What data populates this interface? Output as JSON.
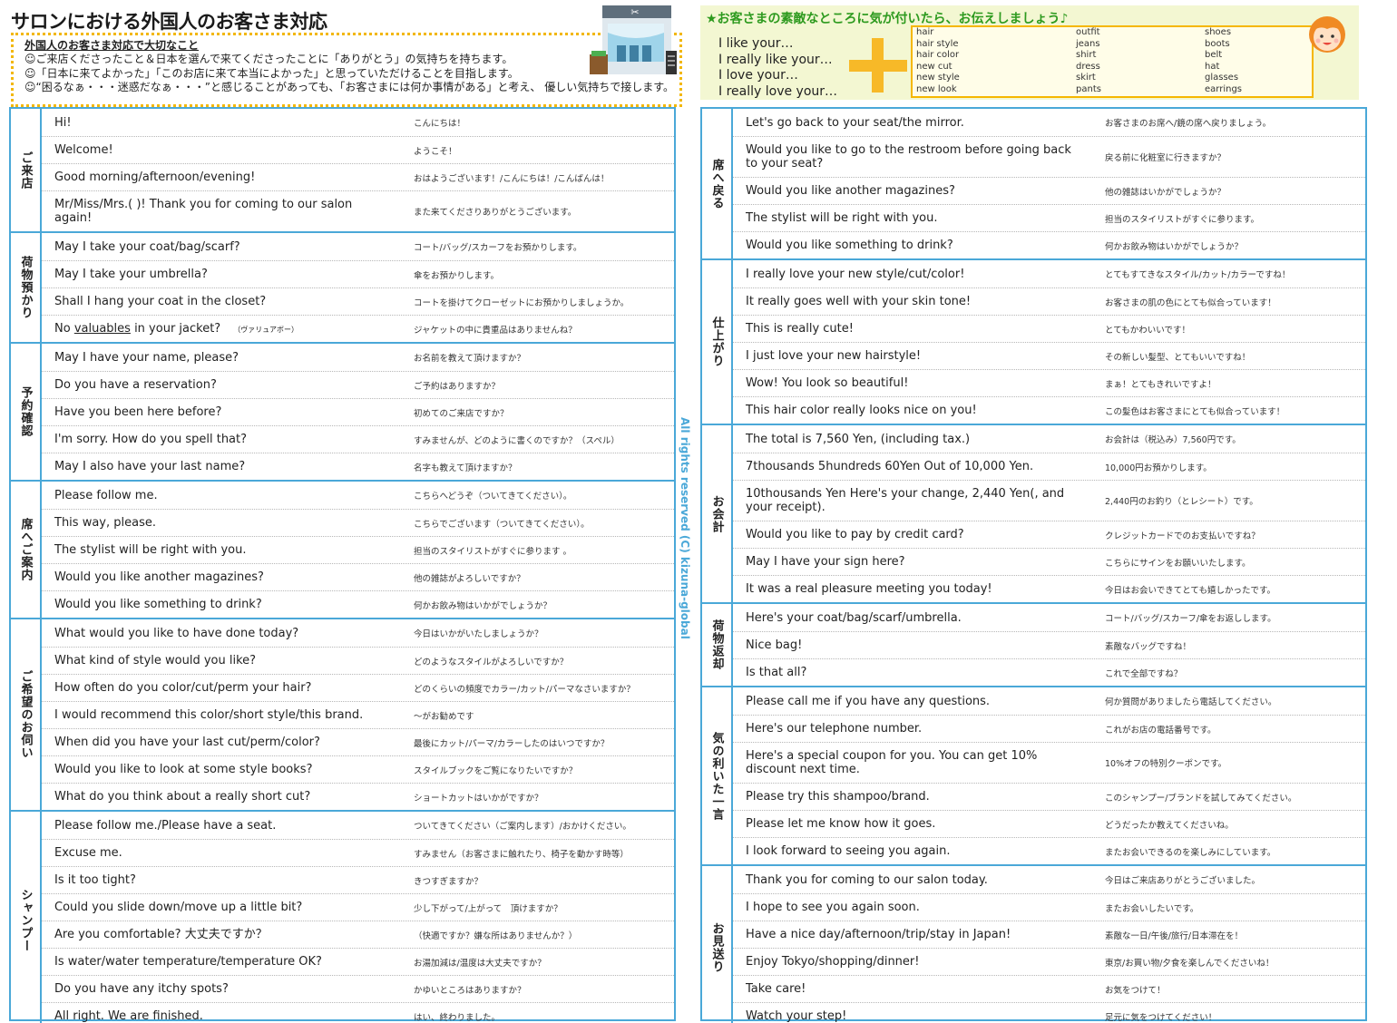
{
  "title": "サロンにおける外国人のお客さま対応",
  "notes": {
    "heading": "外国人のお客さま対応で大切なこと",
    "lines": [
      "☺ご来店くださったこと＆日本を選んで来てくださったことに「ありがとう」の気持ちを持ちます。",
      "☺「日本に来てよかった」「このお店に来て本当によかった」と思っていただけることを目指します。",
      "☺“困るなぁ・・・迷惑だなぁ・・・”と感じることがあっても、「お客さまには何か事情がある」と考え、 優しい気持ちで接します。"
    ]
  },
  "tip": {
    "title": "★お客さまの素敵なところに気が付いたら、お伝えしましょう♪",
    "phrases": [
      "I like your…",
      "I really like your…",
      "I love your…",
      "I really love your…"
    ],
    "words_col1": [
      "hair",
      "hair style",
      "hair color",
      "new cut",
      "new style",
      "new look"
    ],
    "words_col2": [
      "outfit",
      "jeans",
      "shirt",
      "dress",
      "skirt",
      "pants"
    ],
    "words_col3": [
      "shoes",
      "boots",
      "belt",
      "hat",
      "glasses",
      "earrings"
    ]
  },
  "copyright": "All rights reserved (C) kizuna-global",
  "colors": {
    "border": "#4aa8d8",
    "accent_yellow": "#f5b700",
    "tip_green": "#2d9a1e",
    "tip_bg": "#f3f7d2"
  },
  "left_sections": [
    {
      "label": "ご来店",
      "rows": [
        {
          "en": "Hi!",
          "jp": "こんにちは！"
        },
        {
          "en": "Welcome!",
          "jp": "ようこそ！"
        },
        {
          "en": "Good morning/afternoon/evening!",
          "jp": "おはようございます！/こんにちは！/こんばんは！"
        },
        {
          "en": "Mr/Miss/Mrs.(     )! Thank you for coming to our salon again!",
          "jp": "また来てくださりありがとうございます。",
          "tall": true
        }
      ]
    },
    {
      "label": "荷物預かり",
      "rows": [
        {
          "en": "May I take your coat/bag/scarf?",
          "jp": "コート/バッグ/スカーフをお預かりします。"
        },
        {
          "en": "May I take your umbrella?",
          "jp": "傘をお預かりします。"
        },
        {
          "en": "Shall I hang your coat in the closet?",
          "jp": "コートを掛けてクローゼットにお預かりしましょうか。"
        },
        {
          "en_pre": "No ",
          "en_u": "valuables",
          "en_post": " in your jacket?",
          "en_small": "（ヴァリュアボー）",
          "jp": "ジャケットの中に貴重品はありませんね？"
        }
      ]
    },
    {
      "label": "予約確認",
      "rows": [
        {
          "en": "May I have your name, please?",
          "jp": "お名前を教えて頂けますか？"
        },
        {
          "en": "Do you have a reservation?",
          "jp": "ご予約はありますか？"
        },
        {
          "en": "Have you been here before?",
          "jp": "初めてのご来店ですか？"
        },
        {
          "en": "I'm sorry. How do you spell that?",
          "jp": "すみませんが、どのように書くのですか？（スペル）"
        },
        {
          "en": "May I also have your last name?",
          "jp": "名字も教えて頂けますか？"
        }
      ]
    },
    {
      "label": "席へご案内",
      "rows": [
        {
          "en": "Please follow me.",
          "jp": "こちらへどうぞ（ついてきてください）。"
        },
        {
          "en": "This way, please.",
          "jp": "こちらでございます（ついてきてください）。"
        },
        {
          "en": "The stylist will be right with you.",
          "jp": "担当のスタイリストがすぐに参ります 。"
        },
        {
          "en": "Would you like another magazines?",
          "jp": "他の雑誌がよろしいですか？"
        },
        {
          "en": "Would you like something to drink?",
          "jp": "何かお飲み物はいかがでしょうか？"
        }
      ]
    },
    {
      "label": "ご希望のお伺い",
      "rows": [
        {
          "en": "What would you like to have done today?",
          "jp": "今日はいかがいたしましょうか？"
        },
        {
          "en": "What kind of style would you like?",
          "jp": "どのようなスタイルがよろしいですか？"
        },
        {
          "en": "How often do you color/cut/perm your hair?",
          "jp": "どのくらいの頻度でカラー/カット/パーマなさいますか？"
        },
        {
          "en": "I would recommend this color/short style/this brand.",
          "jp": "～がお勧めです"
        },
        {
          "en": "When did you have your last cut/perm/color?",
          "jp": "最後にカット/パーマ/カラーしたのはいつですか？"
        },
        {
          "en": "Would you like to look at some style books?",
          "jp": "スタイルブックをご覧になりたいですか？"
        },
        {
          "en": "What do you think about a really short cut?",
          "jp": "ショートカットはいかがですか？"
        }
      ]
    },
    {
      "label": "シャンプー",
      "rows": [
        {
          "en": "Please follow me./Please have a seat.",
          "jp": "ついてきてください（ご案内します）/おかけください。"
        },
        {
          "en": "Excuse me.",
          "jp": "すみません（お客さまに触れたり、椅子を動かす時等）"
        },
        {
          "en": "Is it too tight?",
          "jp": "きつすぎますか？"
        },
        {
          "en": "Could you slide down/move up a little bit?",
          "jp": "少し下がって/上がって　頂けますか？"
        },
        {
          "en": "Are you comfortable? 大丈夫ですか？",
          "jp": "（快適ですか？嫌な所はありませんか？）"
        },
        {
          "en": "Is water/water temperature/temperature OK?",
          "jp": "お湯加減は/温度は大丈夫ですか？"
        },
        {
          "en": "Do you have any itchy spots?",
          "jp": "かゆいところはありますか？"
        },
        {
          "en": "All right. We are finished.",
          "jp": "はい、終わりました。"
        }
      ]
    }
  ],
  "right_sections": [
    {
      "label": "席へ戻る",
      "rows": [
        {
          "en": "Let's go back to your seat/the mirror.",
          "jp": "お客さまのお席へ/鏡の席へ戻りましょう。"
        },
        {
          "en": "Would you like to go to the restroom before going back to your seat?",
          "jp": "戻る前に化粧室に行きますか？",
          "tall": true
        },
        {
          "en": "Would you like another magazines?",
          "jp": "他の雑誌はいかがでしょうか？"
        },
        {
          "en": "The stylist will be right with you.",
          "jp": "担当のスタイリストがすぐに参ります。"
        },
        {
          "en": "Would you like something to drink?",
          "jp": "何かお飲み物はいかがでしょうか？"
        }
      ]
    },
    {
      "label": "仕上がり",
      "rows": [
        {
          "en": "I really love your new style/cut/color!",
          "jp": "とてもすてきなスタイル/カット/カラーですね！"
        },
        {
          "en": "It really goes well with your skin tone!",
          "jp": "お客さまの肌の色にとても似合っています！"
        },
        {
          "en": "This is really cute!",
          "jp": "とてもかわいいです！"
        },
        {
          "en": "I just love your new hairstyle!",
          "jp": "その新しい髪型、とてもいいですね！"
        },
        {
          "en": "Wow! You look so beautiful!",
          "jp": "まぁ！とてもきれいですよ！"
        },
        {
          "en": "This hair color really looks nice on you!",
          "jp": "この髪色はお客さまにとても似合っています！"
        }
      ]
    },
    {
      "label": "お会計",
      "rows": [
        {
          "en": "The total is 7,560 Yen, (including tax.)",
          "jp": "お会計は（税込み）7,560円です。"
        },
        {
          "en": "7thousands 5hundreds 60Yen Out of 10,000 Yen.",
          "jp": "10,000円お預かりします。"
        },
        {
          "en": "10thousands Yen Here's your change, 2,440 Yen(, and your receipt).",
          "jp": "2,440円のお釣り（とレシート）です。",
          "tall": true
        },
        {
          "en": "Would you like to pay by credit card?",
          "jp": "クレジットカードでのお支払いですね？"
        },
        {
          "en": "May I have your sign here?",
          "jp": "こちらにサインをお願いいたします。"
        },
        {
          "en": "It was a real pleasure meeting you today!",
          "jp": "今日はお会いできてとても嬉しかったです。"
        }
      ]
    },
    {
      "label": "荷物返却",
      "rows": [
        {
          "en": "Here's your coat/bag/scarf/umbrella.",
          "jp": "コート/バッグ/スカーフ/傘をお返しします。"
        },
        {
          "en": "Nice bag!",
          "jp": "素敵なバッグですね！"
        },
        {
          "en": "Is that all?",
          "jp": "これで全部ですね？"
        }
      ]
    },
    {
      "label": "気の利いた一言",
      "rows": [
        {
          "en": "Please call me if you have any questions.",
          "jp": "何か質問がありましたら電話してください。"
        },
        {
          "en": "Here's our telephone number.",
          "jp": "これがお店の電話番号です。"
        },
        {
          "en": "Here's a special coupon for you. You can get 10% discount next time.",
          "jp": "10%オフの特別クーポンです。",
          "tall": true
        },
        {
          "en": "Please try this shampoo/brand.",
          "jp": "このシャンプー/ブランドを試してみてください。"
        },
        {
          "en": "Please let me know how it goes.",
          "jp": "どうだったか教えてくださいね。"
        },
        {
          "en": "I look forward to seeing you again.",
          "jp": "またお会いできるのを楽しみにしています。"
        }
      ]
    },
    {
      "label": "お見送り",
      "rows": [
        {
          "en": "Thank you for coming to our salon today.",
          "jp": "今日はご来店ありがとうございました。"
        },
        {
          "en": "I hope to see you again soon.",
          "jp": "またお会いしたいです。"
        },
        {
          "en": "Have a nice day/afternoon/trip/stay in Japan!",
          "jp": "素敵な一日/午後/旅行/日本滞在を！"
        },
        {
          "en": "Enjoy Tokyo/shopping/dinner!",
          "jp": "東京/お買い物/夕食を楽しんでくださいね！"
        },
        {
          "en": "Take care!",
          "jp": "お気をつけて！"
        },
        {
          "en": "Watch your step!",
          "jp": "足元に気をつけてください！"
        }
      ]
    }
  ]
}
